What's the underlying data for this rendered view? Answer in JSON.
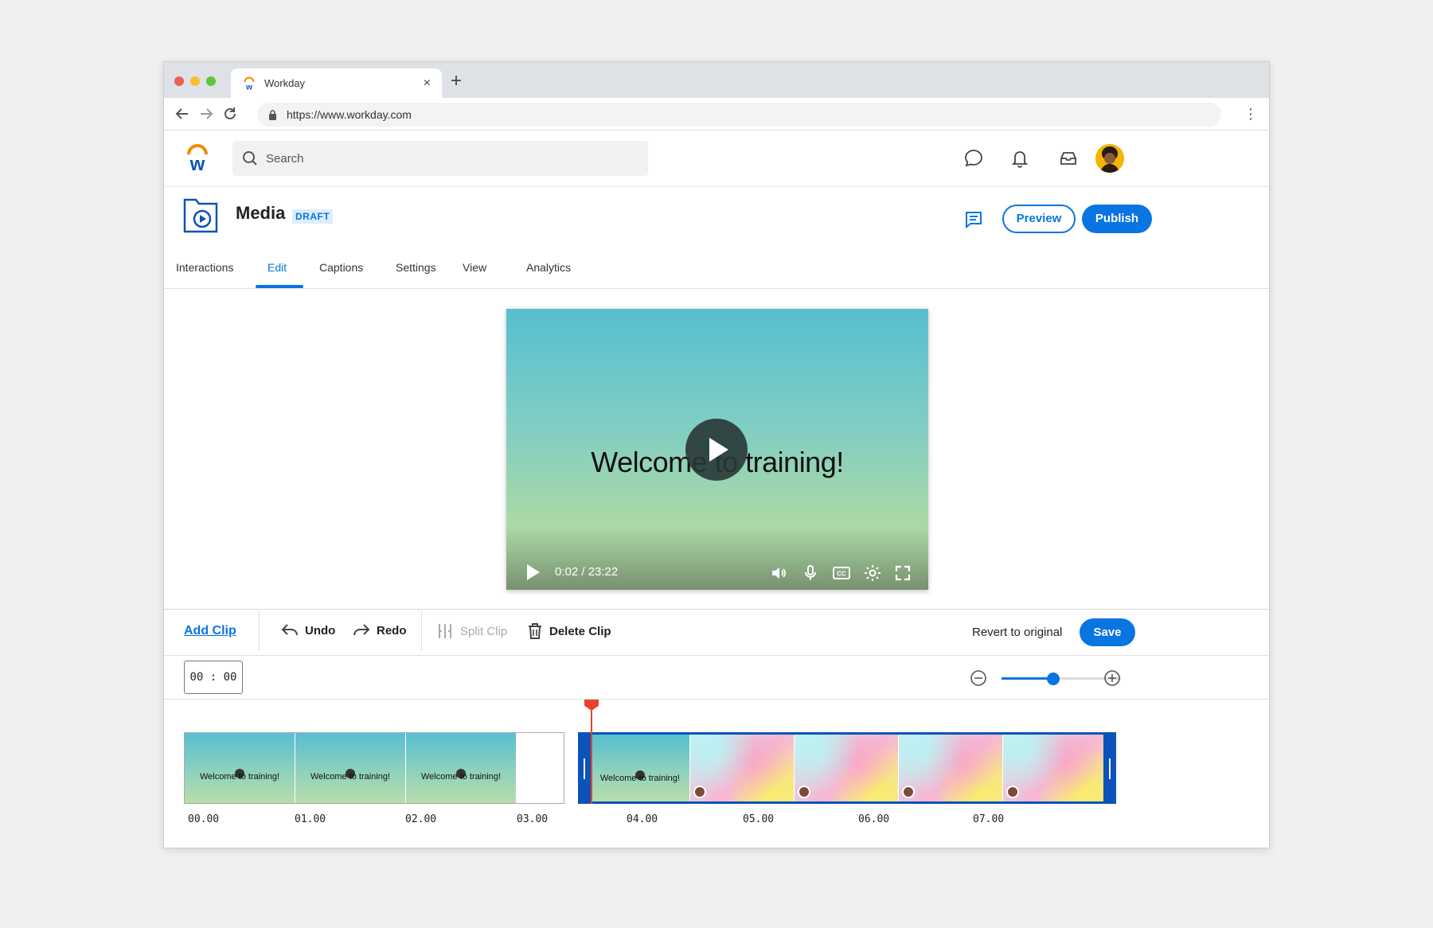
{
  "browser": {
    "tab_title": "Workday",
    "tab_close": "×",
    "new_tab": "+",
    "url": "https://www.workday.com",
    "menu": "⋮"
  },
  "header": {
    "search_placeholder": "Search",
    "icons": [
      "chat-icon",
      "bell-icon",
      "inbox-icon",
      "avatar"
    ]
  },
  "page": {
    "title": "Media",
    "badge": "DRAFT",
    "preview_label": "Preview",
    "publish_label": "Publish"
  },
  "tabs": [
    {
      "label": "Interactions"
    },
    {
      "label": "Edit",
      "active": true
    },
    {
      "label": "Captions"
    },
    {
      "label": "Settings"
    },
    {
      "label": "View"
    },
    {
      "label": "Analytics"
    }
  ],
  "video": {
    "overlay_text": "Welcome to training!",
    "time": "0:02 / 23:22",
    "control_icons": [
      "volume-icon",
      "microphone-icon",
      "closed-captions-icon",
      "settings-gear-icon",
      "fullscreen-icon"
    ]
  },
  "toolbar": {
    "add_clip": "Add Clip",
    "undo": "Undo",
    "redo": "Redo",
    "split_clip": "Split Clip",
    "delete_clip": "Delete Clip",
    "revert": "Revert to original",
    "save": "Save"
  },
  "timeline": {
    "timecode": "00 : 00",
    "zoom_level": 0.43,
    "clip1_frame_text": "Welcome to training!",
    "ticks": [
      "00.00",
      "01.00",
      "02.00",
      "03.00",
      "04.00",
      "05.00",
      "06.00",
      "07.00"
    ]
  },
  "colors": {
    "accent": "#0875e1",
    "playhead": "#e8432a",
    "selected_clip_border": "#0b53b8"
  }
}
